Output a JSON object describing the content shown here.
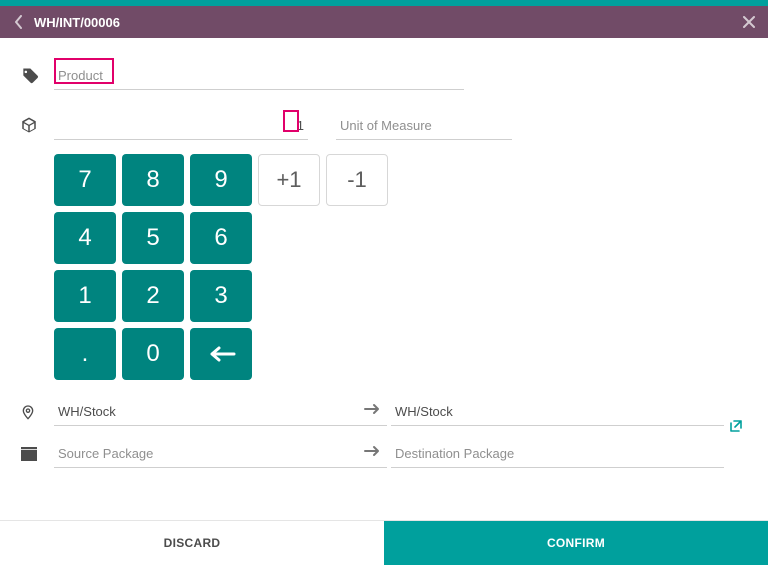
{
  "header": {
    "title": "WH/INT/00006"
  },
  "product": {
    "placeholder": "Product",
    "value": ""
  },
  "quantity": {
    "value": "1"
  },
  "uom": {
    "placeholder": "Unit of Measure",
    "value": ""
  },
  "keypad": {
    "rows": [
      [
        "7",
        "8",
        "9",
        "+1",
        "-1"
      ],
      [
        "4",
        "5",
        "6"
      ],
      [
        "1",
        "2",
        "3"
      ],
      [
        ".",
        "0",
        "⟵"
      ]
    ]
  },
  "source_location": {
    "value": "WH/Stock"
  },
  "dest_location": {
    "value": "WH/Stock"
  },
  "source_package": {
    "placeholder": "Source Package",
    "value": ""
  },
  "dest_package": {
    "placeholder": "Destination Package",
    "value": ""
  },
  "footer": {
    "discard": "DISCARD",
    "confirm": "CONFIRM"
  }
}
